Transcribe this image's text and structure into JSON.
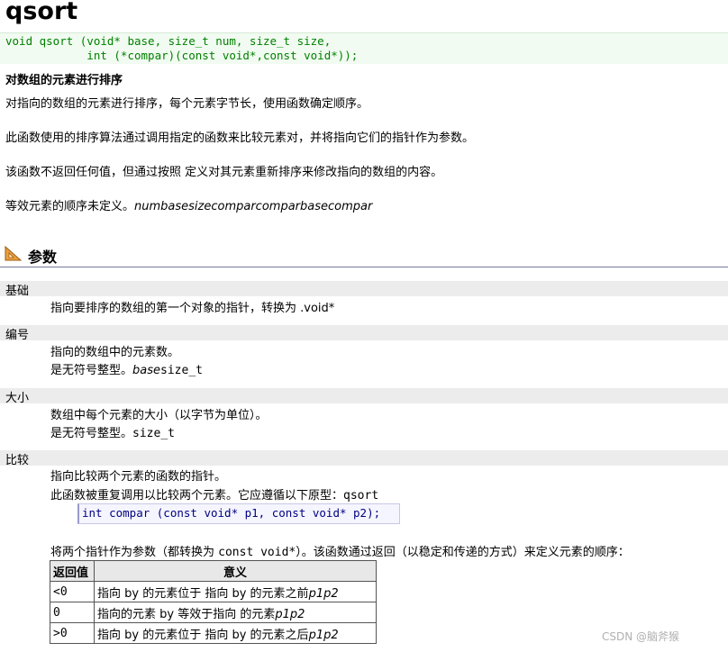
{
  "title": "qsort",
  "prototype": {
    "line1": "void qsort (void* base, size_t num, size_t size,",
    "line2": "            int (*compar)(const void*,const void*));"
  },
  "subtitle": "对数组的元素进行排序",
  "paragraphs": [
    "对指向的数组的元素进行排序，每个元素字节长，使用函数确定顺序。",
    "此函数使用的排序算法通过调用指定的函数来比较元素对，并将指向它们的指针作为参数。",
    "该函数不返回任何值，但通过按照 定义对其元素重新排序来修改指向的数组的内容。"
  ],
  "para4": {
    "text": "等效元素的顺序未定义。",
    "italic": "numbasesizecomparcomparbasecompar"
  },
  "params_section": {
    "title": "参数"
  },
  "params": {
    "base": {
      "term": "基础",
      "line1": "指向要排序的数组的第一个对象的指针，转换为 .void*"
    },
    "num": {
      "term": "编号",
      "line1": "指向的数组中的元素数。",
      "line2_text": "是无符号整型。",
      "line2_italic": "base",
      "line2_code": "size_t"
    },
    "size": {
      "term": "大小",
      "line1": "数组中每个元素的大小（以字节为单位）。",
      "line2_text": "是无符号整型。",
      "line2_code": "size_t"
    },
    "compar": {
      "term": "比较",
      "line1": "指向比较两个元素的函数的指针。",
      "line2_text": "此函数被重复调用以比较两个元素。它应遵循以下原型：",
      "line2_code": "qsort",
      "code": "int compar (const void* p1, const void* p2);",
      "line3_a": "将两个指针作为参数（都转换为 ",
      "line3_code": "const void*",
      "line3_b": "）。该函数通过返回（以稳定和传递的方式）来定义元素的顺序："
    }
  },
  "return_table": {
    "headers": [
      "返回值",
      "意义"
    ],
    "rows": [
      {
        "value": "<0",
        "text": "指向 by 的元素位于 指向 by 的元素之前",
        "italic": "p1p2"
      },
      {
        "value": "0",
        "text": "指向的元素 by 等效于指向 的元素",
        "italic": "p1p2"
      },
      {
        "value": ">0",
        "text": "指向 by 的元素位于 指向 by 的元素之后",
        "italic": "p1p2"
      }
    ]
  },
  "watermark": "CSDN @脑斧猴",
  "colors": {
    "code_green": "#008000",
    "proto_bg": "#f1fbf1",
    "term_bg": "#ececec",
    "code_box_bg": "#f5f5ff"
  }
}
